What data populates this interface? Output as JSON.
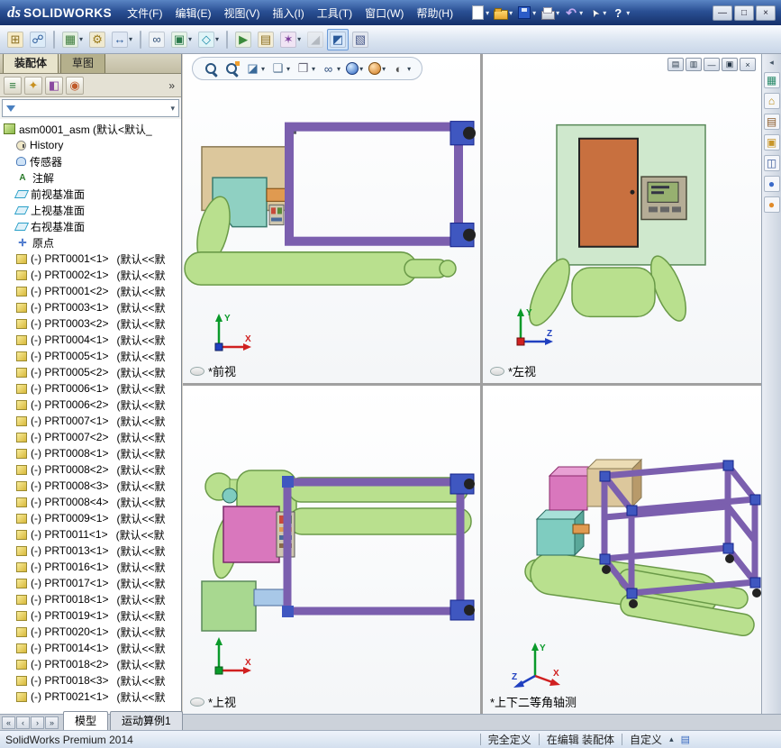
{
  "colors": {
    "model_green": "#b9e08e",
    "frame_purple": "#7b5fae",
    "corner_blue": "#3f57c0",
    "box_tan": "#dcc79c",
    "box_teal": "#7fccc0",
    "box_pink": "#d977bd",
    "door_orange": "#c8703f",
    "panel_green": "#cfe8cd",
    "titlebar_blue": "#2a5094"
  },
  "titlebar": {
    "logo_prefix": "ds",
    "logo_text": "SOLIDWORKS",
    "menus": [
      {
        "label": "文件(F)"
      },
      {
        "label": "编辑(E)"
      },
      {
        "label": "视图(V)"
      },
      {
        "label": "插入(I)"
      },
      {
        "label": "工具(T)"
      },
      {
        "label": "窗口(W)"
      },
      {
        "label": "帮助(H)"
      }
    ],
    "quick_icons": [
      {
        "name": "new-document-icon",
        "kind": "new",
        "dropdown": true
      },
      {
        "name": "open-icon",
        "kind": "open",
        "dropdown": true
      },
      {
        "name": "save-icon",
        "kind": "save",
        "dropdown": true
      },
      {
        "name": "print-icon",
        "kind": "print",
        "dropdown": true
      },
      {
        "name": "undo-icon",
        "kind": "undo",
        "dropdown": true
      },
      {
        "name": "select-icon",
        "kind": "select",
        "dropdown": true
      },
      {
        "name": "help-icon",
        "kind": "help",
        "dropdown": true
      }
    ],
    "window_controls": [
      {
        "name": "window-minimize-button",
        "glyph": "—"
      },
      {
        "name": "window-restore-button",
        "glyph": "□"
      },
      {
        "name": "window-close-button",
        "glyph": "×"
      }
    ]
  },
  "toolbar": {
    "icons": [
      {
        "name": "insert-component-button",
        "glyph": "⊞",
        "bg": "#f7ecc9",
        "fg": "#8a6d1f"
      },
      {
        "name": "mate-button",
        "glyph": "☍",
        "bg": "#dcebf8",
        "fg": "#2a5a9a"
      },
      {
        "sep": true
      },
      {
        "name": "linear-component-pattern-button",
        "glyph": "▦",
        "bg": "#e4f0e0",
        "fg": "#3a7a3a",
        "dropdown": true
      },
      {
        "name": "smart-fasteners-button",
        "glyph": "⚙",
        "bg": "#f0ead0",
        "fg": "#9a7a1a"
      },
      {
        "name": "move-component-button",
        "glyph": "↔",
        "bg": "#e0e8f4",
        "fg": "#2a5a9a",
        "dropdown": true
      },
      {
        "sep": true
      },
      {
        "name": "show-hidden-components-button",
        "glyph": "∞",
        "bg": "#eef2f6",
        "fg": "#33527a"
      },
      {
        "name": "assembly-features-button",
        "glyph": "▣",
        "bg": "#e8f4e8",
        "fg": "#2a7a4a",
        "dropdown": true
      },
      {
        "name": "reference-geometry-button",
        "glyph": "◇",
        "bg": "#e0f4f8",
        "fg": "#1a8aa8",
        "dropdown": true
      },
      {
        "sep": true
      },
      {
        "name": "new-motion-study-button",
        "glyph": "▶",
        "bg": "#e8f0e0",
        "fg": "#3a8a3a"
      },
      {
        "name": "bill-of-materials-button",
        "glyph": "▤",
        "bg": "#f4eed8",
        "fg": "#8a6d1f"
      },
      {
        "name": "exploded-view-button",
        "glyph": "✶",
        "bg": "#f0e4f4",
        "fg": "#7a3a9a",
        "dropdown": true
      },
      {
        "name": "instant3d-button",
        "glyph": "◢",
        "bg": "#e8e8e8",
        "fg": "#888",
        "disabled": true
      },
      {
        "name": "interference-detection-button",
        "glyph": "◩",
        "bg": "#d8e8fa",
        "fg": "#2a5a9a",
        "pressed": true
      },
      {
        "name": "simulation-button",
        "glyph": "▧",
        "bg": "#e4e8f0",
        "fg": "#4a5a8a"
      }
    ]
  },
  "left_panel": {
    "command_tabs": [
      {
        "name": "tab-assembly",
        "label": "装配体",
        "active": true
      },
      {
        "name": "tab-sketch",
        "label": "草图",
        "active": false
      }
    ],
    "fm_tabs": [
      {
        "name": "featuremanager-tab-icon",
        "glyph": "≡",
        "fg": "#2a7a3a"
      },
      {
        "name": "propertymanager-tab-icon",
        "glyph": "✦",
        "fg": "#c89020"
      },
      {
        "name": "configurationmanager-tab-icon",
        "glyph": "◧",
        "fg": "#8a4aa0"
      },
      {
        "name": "displaymanager-tab-icon",
        "glyph": "◉",
        "fg": "#c05a2a"
      }
    ],
    "pane_chevron": "»",
    "tree": {
      "root_label": "asm0001_asm (默认<默认_",
      "items": [
        {
          "icon": "history",
          "label": "History",
          "config": ""
        },
        {
          "icon": "sensor",
          "label": "传感器",
          "config": ""
        },
        {
          "icon": "annotation",
          "label": "注解",
          "config": ""
        },
        {
          "icon": "plane",
          "label": "前视基准面",
          "config": ""
        },
        {
          "icon": "plane",
          "label": "上视基准面",
          "config": ""
        },
        {
          "icon": "plane",
          "label": "右视基准面",
          "config": ""
        },
        {
          "icon": "origin",
          "label": "原点",
          "config": ""
        },
        {
          "icon": "part",
          "label": "(-) PRT0001<1>",
          "config": "(默认<<默"
        },
        {
          "icon": "part",
          "label": "(-) PRT0002<1>",
          "config": "(默认<<默"
        },
        {
          "icon": "part",
          "label": "(-) PRT0001<2>",
          "config": "(默认<<默"
        },
        {
          "icon": "part",
          "label": "(-) PRT0003<1>",
          "config": "(默认<<默"
        },
        {
          "icon": "part",
          "label": "(-) PRT0003<2>",
          "config": "(默认<<默"
        },
        {
          "icon": "part",
          "label": "(-) PRT0004<1>",
          "config": "(默认<<默"
        },
        {
          "icon": "part",
          "label": "(-) PRT0005<1>",
          "config": "(默认<<默"
        },
        {
          "icon": "part",
          "label": "(-) PRT0005<2>",
          "config": "(默认<<默"
        },
        {
          "icon": "part",
          "label": "(-) PRT0006<1>",
          "config": "(默认<<默"
        },
        {
          "icon": "part",
          "label": "(-) PRT0006<2>",
          "config": "(默认<<默"
        },
        {
          "icon": "part",
          "label": "(-) PRT0007<1>",
          "config": "(默认<<默"
        },
        {
          "icon": "part",
          "label": "(-) PRT0007<2>",
          "config": "(默认<<默"
        },
        {
          "icon": "part",
          "label": "(-) PRT0008<1>",
          "config": "(默认<<默"
        },
        {
          "icon": "part",
          "label": "(-) PRT0008<2>",
          "config": "(默认<<默"
        },
        {
          "icon": "part",
          "label": "(-) PRT0008<3>",
          "config": "(默认<<默"
        },
        {
          "icon": "part",
          "label": "(-) PRT0008<4>",
          "config": "(默认<<默"
        },
        {
          "icon": "part",
          "label": "(-) PRT0009<1>",
          "config": "(默认<<默"
        },
        {
          "icon": "part",
          "label": "(-) PRT0011<1>",
          "config": "(默认<<默"
        },
        {
          "icon": "part",
          "label": "(-) PRT0013<1>",
          "config": "(默认<<默"
        },
        {
          "icon": "part",
          "label": "(-) PRT0016<1>",
          "config": "(默认<<默"
        },
        {
          "icon": "part",
          "label": "(-) PRT0017<1>",
          "config": "(默认<<默"
        },
        {
          "icon": "part",
          "label": "(-) PRT0018<1>",
          "config": "(默认<<默"
        },
        {
          "icon": "part",
          "label": "(-) PRT0019<1>",
          "config": "(默认<<默"
        },
        {
          "icon": "part",
          "label": "(-) PRT0020<1>",
          "config": "(默认<<默"
        },
        {
          "icon": "part",
          "label": "(-) PRT0014<1>",
          "config": "(默认<<默"
        },
        {
          "icon": "part",
          "label": "(-) PRT0018<2>",
          "config": "(默认<<默"
        },
        {
          "icon": "part",
          "label": "(-) PRT0018<3>",
          "config": "(默认<<默"
        },
        {
          "icon": "part",
          "label": "(-) PRT0021<1>",
          "config": "(默认<<默"
        }
      ]
    }
  },
  "headsup": {
    "icons": [
      {
        "name": "zoom-to-fit-button",
        "kind": "mag"
      },
      {
        "name": "zoom-to-area-button",
        "kind": "mag2"
      },
      {
        "name": "section-view-button",
        "kind": "glyph",
        "glyph": "◪",
        "fg": "#3a6a9a",
        "dropdown": true
      },
      {
        "name": "view-orientation-button",
        "kind": "glyph",
        "glyph": "❑",
        "fg": "#4a6a8a",
        "dropdown": true
      },
      {
        "name": "display-style-button",
        "kind": "glyph",
        "glyph": "❒",
        "fg": "#667",
        "dropdown": true
      },
      {
        "name": "hide-show-items-button",
        "kind": "glyph",
        "glyph": "∞",
        "fg": "#2a4a7a",
        "dropdown": true
      },
      {
        "name": "edit-appearance-button",
        "kind": "ball-blue",
        "dropdown": true
      },
      {
        "name": "apply-scene-button",
        "kind": "ball-orange",
        "dropdown": true
      },
      {
        "name": "view-settings-button",
        "kind": "glyph",
        "glyph": "◐",
        "fg": "#555",
        "dropdown": true
      }
    ]
  },
  "doc_controls": [
    {
      "name": "doc-cascade-button",
      "glyph": "▤"
    },
    {
      "name": "doc-tile-button",
      "glyph": "▥"
    },
    {
      "name": "doc-minimize-button",
      "glyph": "—"
    },
    {
      "name": "doc-restore-button",
      "glyph": "▣"
    },
    {
      "name": "doc-close-button",
      "glyph": "×"
    }
  ],
  "viewports": [
    {
      "label": "*前视",
      "axis_up": "Y",
      "axis_right": "X"
    },
    {
      "label": "*左视",
      "axis_up": "Y",
      "axis_right": "Z"
    },
    {
      "label": "*上视",
      "axis_up": "",
      "axis_right": "X"
    },
    {
      "label": "*上下二等角轴测",
      "axis_up": "Y",
      "axis_right": "X",
      "axis_left": "Z"
    }
  ],
  "task_pane": {
    "icons": [
      {
        "name": "display-pane-icon",
        "glyph": "▦",
        "fg": "#2a8a6a"
      },
      {
        "name": "solidworks-resources-icon",
        "glyph": "⌂",
        "fg": "#b8860b"
      },
      {
        "name": "design-library-icon",
        "glyph": "▤",
        "fg": "#8a5a2a"
      },
      {
        "name": "file-explorer-icon",
        "glyph": "▣",
        "fg": "#c8962a"
      },
      {
        "name": "view-palette-icon",
        "glyph": "◫",
        "fg": "#3a5a9a"
      },
      {
        "name": "appearances-icon",
        "glyph": "●",
        "fg": "#3a6ac8"
      },
      {
        "name": "scenes-icon",
        "glyph": "●",
        "fg": "#e08a2a"
      }
    ]
  },
  "bottom_bar": {
    "nav": [
      "«",
      "‹",
      "›",
      "»"
    ],
    "tabs": [
      {
        "name": "tab-model",
        "label": "模型",
        "active": true
      },
      {
        "name": "tab-motion-study-1",
        "label": "运动算例1",
        "active": false
      }
    ]
  },
  "status_bar": {
    "product": "SolidWorks Premium 2014",
    "define_state": "完全定义",
    "edit_state": "在编辑 装配体",
    "custom": "自定义",
    "custom_arrow": "▴",
    "icon_glyph": "▤"
  }
}
